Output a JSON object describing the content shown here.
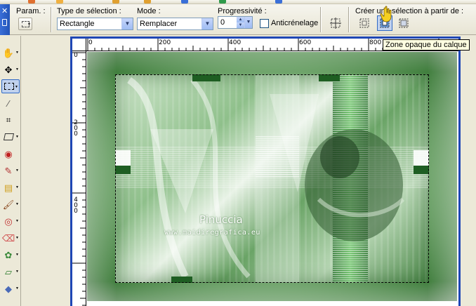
{
  "options": {
    "params_label": "Param. :",
    "selection_type_label": "Type de sélection :",
    "selection_type_value": "Rectangle",
    "mode_label": "Mode :",
    "mode_value": "Remplacer",
    "progressivite_label": "Progressivité :",
    "progressivite_value": "0",
    "antialias_label": "Anticrénelage",
    "create_from_label": "Créer une sélection à partir de :"
  },
  "tooltip": {
    "text": "Zone opaque du calque"
  },
  "ruler": {
    "top_labels": [
      "0",
      "200",
      "400",
      "600",
      "800"
    ],
    "left_labels": [
      "0",
      "2",
      "0",
      "0",
      "4",
      "0",
      "0"
    ]
  },
  "watermark": {
    "title": "Pinuccia",
    "url": "www.maidiregrafica.eu"
  },
  "colors": {
    "window_border": "#1f47b5",
    "palette_blue": "#2354b8",
    "tooltip_bg": "#ffffe1",
    "selected_tool_bg": "#c1d2ee",
    "art_green": "#4e8a4b"
  },
  "icons": {
    "tools": [
      "pan-hand-icon",
      "move-arrows-icon",
      "selection-rect-icon",
      "eyedropper-icon",
      "crop-icon",
      "deform-icon",
      "red-eye-icon",
      "clone-brush-icon",
      "lighten-icon",
      "paint-brush-icon",
      "target-icon",
      "eraser-icon",
      "picture-tube-icon",
      "shape-icon",
      "fill-icon"
    ]
  }
}
